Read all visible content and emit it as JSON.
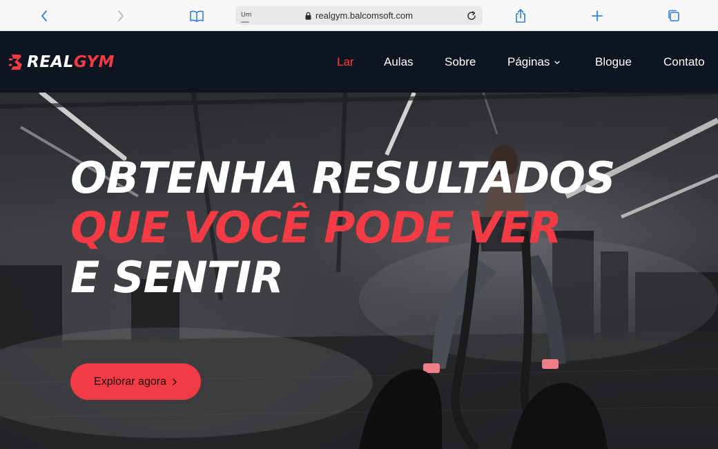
{
  "browser": {
    "url": "realgym.balcomsoft.com",
    "tab_hint": "Um"
  },
  "site": {
    "logo": {
      "part1": "REAL",
      "part2": "GYM"
    },
    "nav": [
      {
        "label": "Lar",
        "active": true
      },
      {
        "label": "Aulas",
        "active": false
      },
      {
        "label": "Sobre",
        "active": false
      },
      {
        "label": "Páginas",
        "active": false,
        "dropdown": true
      },
      {
        "label": "Blogue",
        "active": false
      },
      {
        "label": "Contato",
        "active": false
      }
    ]
  },
  "hero": {
    "line1": "OBTENHA RESULTADOS",
    "line2": "QUE VOCÊ PODE VER",
    "line3": "E SENTIR",
    "cta_label": "Explorar agora",
    "cta_icon": "chevron-right-icon"
  },
  "colors": {
    "accent": "#f23b44",
    "header_bg": "#0f1520"
  }
}
